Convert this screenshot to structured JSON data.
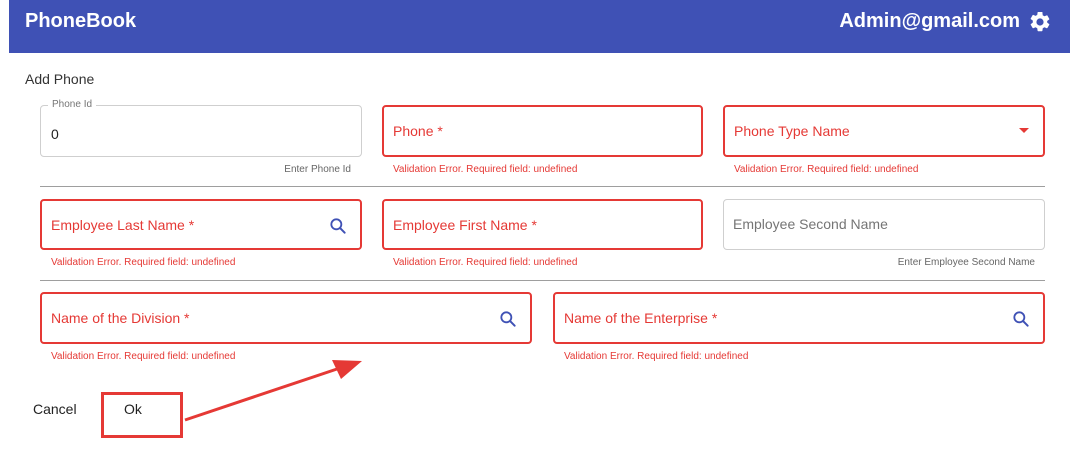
{
  "app": {
    "title": "PhoneBook",
    "user": "Admin@gmail.com"
  },
  "page": {
    "title": "Add Phone"
  },
  "fields": {
    "phone_id": {
      "label": "Phone Id",
      "value": "0",
      "hint": "Enter Phone Id"
    },
    "phone": {
      "label": "Phone *",
      "hint": "Validation Error. Required field: undefined"
    },
    "phone_type": {
      "label": "Phone Type Name",
      "hint": "Validation Error. Required field: undefined"
    },
    "last_name": {
      "label": "Employee Last Name *",
      "hint": "Validation Error. Required field: undefined"
    },
    "first_name": {
      "label": "Employee First Name *",
      "hint": "Validation Error. Required field: undefined"
    },
    "second_name": {
      "label": "Employee Second Name",
      "hint": "Enter Employee Second Name"
    },
    "division": {
      "label": "Name of the Division *",
      "hint": "Validation Error. Required field: undefined"
    },
    "enterprise": {
      "label": "Name of the Enterprise *",
      "hint": "Validation Error. Required field: undefined"
    }
  },
  "actions": {
    "cancel": "Cancel",
    "ok": "Ok"
  },
  "colors": {
    "appbar": "#3f51b5",
    "error": "#e53935",
    "annotation": "#e53935"
  },
  "icons": {
    "settings": "gear-icon",
    "search": "search-icon",
    "dropdown": "dropdown-arrow-icon"
  }
}
